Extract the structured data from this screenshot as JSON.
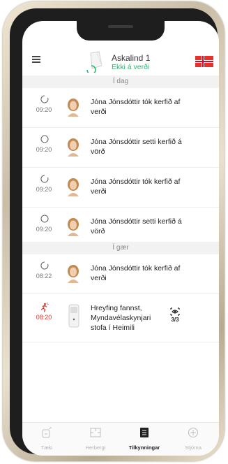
{
  "hub": {
    "name": "Askalind 1",
    "status": "Ekki á verði"
  },
  "sections": {
    "today": "Í dag",
    "yesterday": "Í gær"
  },
  "events": [
    {
      "time": "09:20",
      "text": "Jóna Jónsdóttir tók kerfið af verði"
    },
    {
      "time": "09:20",
      "text": "Jóna Jónsdóttir setti kerfið á vörð"
    },
    {
      "time": "09:20",
      "text": "Jóna Jónsdóttir tók kerfið af verði"
    },
    {
      "time": "09:20",
      "text": "Jóna Jónsdóttir setti kerfið á vörð"
    },
    {
      "time": "08:22",
      "text": "Jóna Jónsdóttir tók kerfið af verði"
    },
    {
      "time": "08:20",
      "text": "Hreyfing fannst, Myndavélaskynjari stofa í Heimili",
      "detections": "3/3"
    }
  ],
  "tabs": [
    {
      "label": "Tæki",
      "icon": "device-icon"
    },
    {
      "label": "Herbergi",
      "icon": "room-icon"
    },
    {
      "label": "Tilkynningar",
      "icon": "notifications-icon"
    },
    {
      "label": "Stjórna",
      "icon": "control-icon"
    }
  ],
  "colors": {
    "accent_green": "#2bb673",
    "alarm_red": "#e5322d",
    "active_tab": "#222222"
  }
}
